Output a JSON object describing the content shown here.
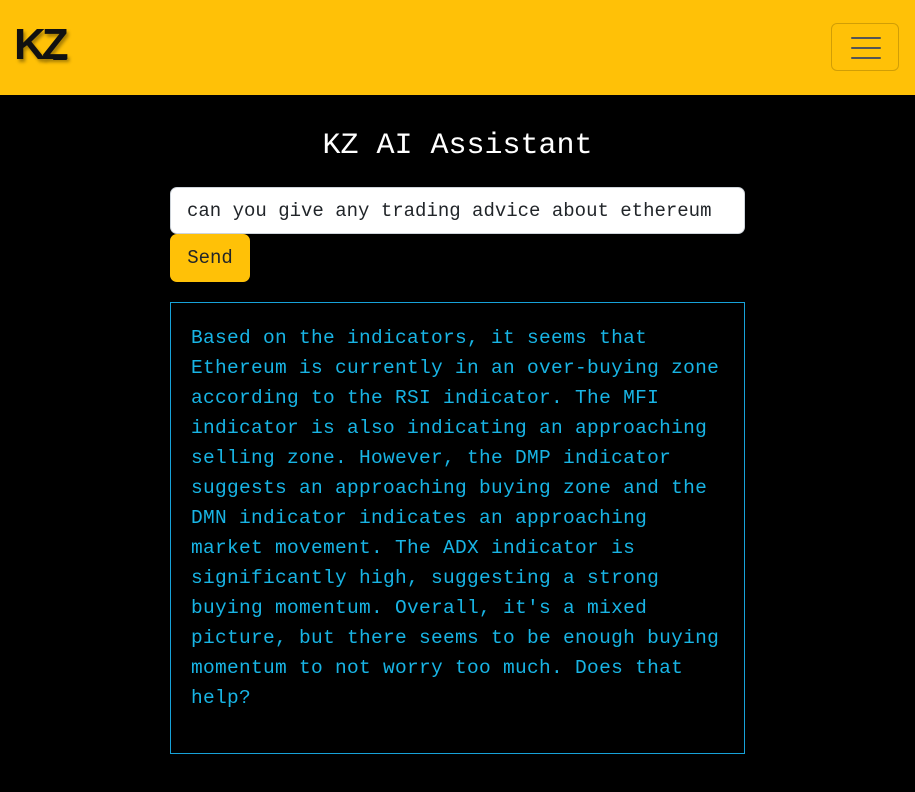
{
  "header": {
    "logo_text": "KZ",
    "menu_icon": "hamburger-menu-icon",
    "accent_color": "#FFC107"
  },
  "main": {
    "title": "KZ AI Assistant",
    "prompt_value": "can you give any trading advice about ethereum",
    "send_label": "Send",
    "response": "Based on the indicators, it seems that Ethereum is currently in an over-buying zone according to the RSI indicator. The MFI indicator is also indicating an approaching selling zone. However, the DMP indicator suggests an approaching buying zone and the DMN indicator indicates an approaching market movement. The ADX indicator is significantly high, suggesting a strong buying momentum. Overall, it's a mixed picture, but there seems to be enough buying momentum to not worry too much. Does that help?",
    "response_color": "#18b4e4"
  }
}
